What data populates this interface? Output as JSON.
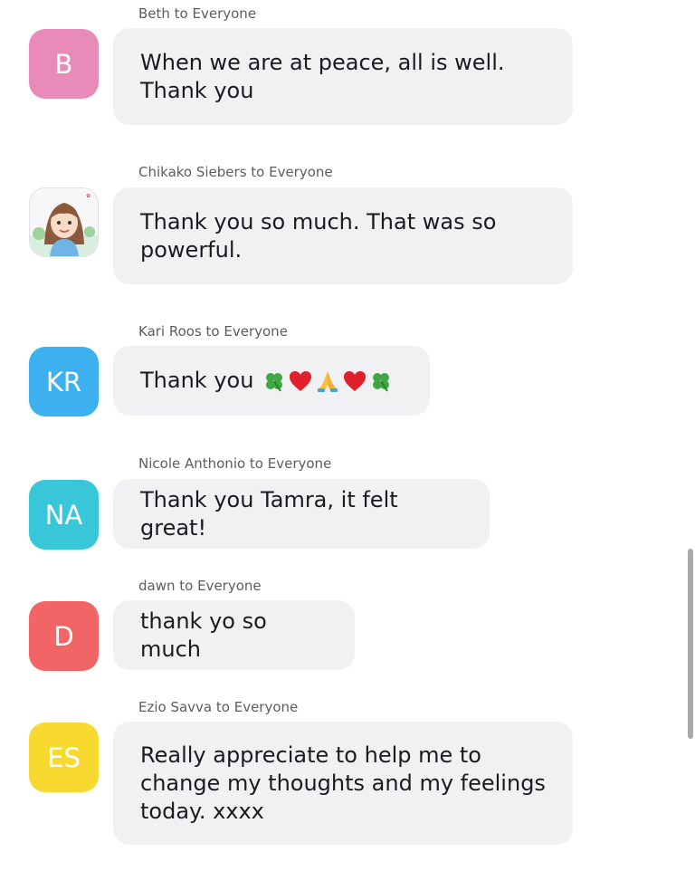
{
  "messages": [
    {
      "sender": "Beth to Everyone",
      "avatar_initials": "B",
      "avatar_color": "#e88bb9",
      "text": "When we are at peace, all is well.\nThank you"
    },
    {
      "sender": "Chikako Siebers to Everyone",
      "avatar_initials": "",
      "avatar_color": "#f4f4f6",
      "avatar_icon": "cartoon-portrait-icon",
      "text": "Thank you so much. That was so\npowerful."
    },
    {
      "sender": "Kari Roos to Everyone",
      "avatar_initials": "KR",
      "avatar_color": "#3db0ef",
      "text": "Thank you",
      "emojis": [
        "four-leaf-clover-icon",
        "red-heart-icon",
        "folded-hands-icon",
        "red-heart-icon",
        "four-leaf-clover-icon"
      ]
    },
    {
      "sender": "Nicole Anthonio to Everyone",
      "avatar_initials": "NA",
      "avatar_color": "#38c6d9",
      "text": "Thank you Tamra, it felt great!"
    },
    {
      "sender": "dawn to Everyone",
      "avatar_initials": "D",
      "avatar_color": "#f16566",
      "text": "thank yo so much"
    },
    {
      "sender": "Ezio Savva to Everyone",
      "avatar_initials": "ES",
      "avatar_color": "#f8d92f",
      "text": "Really appreciate to help me to\nchange my thoughts and my feelings\ntoday. xxxx"
    }
  ],
  "colors": {
    "bubble_bg": "#f1f1f4",
    "sender_text": "#5c5c62",
    "message_text": "#1b1b1f",
    "scrollbar": "#a9a9ad"
  }
}
